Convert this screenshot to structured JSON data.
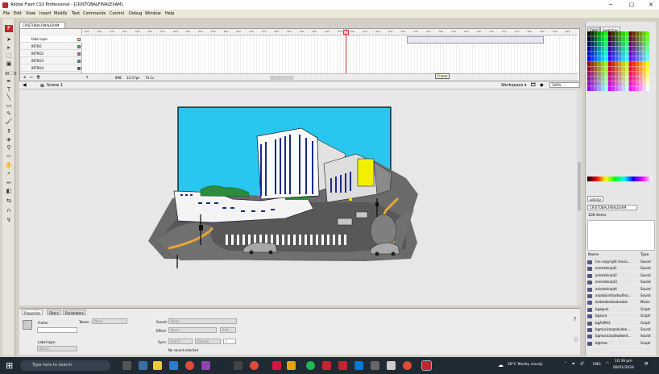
{
  "window": {
    "title": "Adobe Flash CS3 Professional - [CRISTOBALFINALEXAM]",
    "minimize": "─",
    "maximize": "▢",
    "close": "✕"
  },
  "menu": [
    "File",
    "Edit",
    "View",
    "Insert",
    "Modify",
    "Text",
    "Commands",
    "Control",
    "Debug",
    "Window",
    "Help"
  ],
  "document": {
    "tab": "CRISTOBALFINALEXAM",
    "scene": "Scene 1",
    "workspace": "Workspace ▾",
    "zoom": "100%"
  },
  "timeline": {
    "layers": [
      {
        "name": "fade layer",
        "color": "#ffee33"
      },
      {
        "name": "INTRO",
        "color": "#33cc66"
      },
      {
        "name": "INTRO2",
        "color": "#cc44cc"
      },
      {
        "name": "INTRO3",
        "color": "#33aa88"
      },
      {
        "name": "INTRO4",
        "color": "#555555"
      }
    ],
    "ruler": [
      "805",
      "810",
      "815",
      "820",
      "825",
      "830",
      "835",
      "840",
      "845",
      "850",
      "855",
      "860",
      "865",
      "870",
      "875",
      "880",
      "885",
      "890",
      "895",
      "900",
      "905",
      "910",
      "915",
      "920",
      "925",
      "930",
      "935",
      "940",
      "945",
      "950",
      "955",
      "960",
      "965",
      "970",
      "975",
      "980",
      "985",
      "990",
      "995"
    ],
    "frame": "898",
    "fps": "12.0 fps",
    "time": "74.1s",
    "tooltip": "Frame"
  },
  "properties": {
    "tabs": [
      "Properties",
      "Filters",
      "Parameters"
    ],
    "type": "Frame",
    "tween_label": "Tween:",
    "tween": "None",
    "sound_label": "Sound:",
    "sound": "None",
    "effect_label": "Effect:",
    "effect": "None",
    "edit": "Edit...",
    "sync_label": "Sync:",
    "sync": "Event",
    "repeat": "Repeat",
    "repeat_count": "1",
    "frame_label_title": "Label type:",
    "label_type": "Name",
    "no_sound": "No sound selected"
  },
  "panels": {
    "color_tab": "Color",
    "swatches_tab": "Swatches",
    "library_tab": "Library",
    "library_doc": "CRISTOBALFINALEXAM",
    "library_count": "106 items",
    "col_name": "Name",
    "col_type": "Type",
    "items": [
      {
        "name": "[no copyright music...",
        "type": "Sound"
      },
      {
        "name": "animationpt1",
        "type": "Sound"
      },
      {
        "name": "animationpt2",
        "type": "Sound"
      },
      {
        "name": "animationpt3",
        "type": "Sound"
      },
      {
        "name": "animationpt4",
        "type": "Sound"
      },
      {
        "name": "anjdaiijiinfoadoufina...",
        "type": "Sound"
      },
      {
        "name": "asdasdasdasdasdas",
        "type": "Movie"
      },
      {
        "name": "bgagum",
        "type": "Graph"
      },
      {
        "name": "bgaura",
        "type": "Graph"
      },
      {
        "name": "bgAURA2",
        "type": "Graph"
      },
      {
        "name": "bgmusicaaaahuebe...",
        "type": "Sound"
      },
      {
        "name": "bgmusicasjdiwdwed...",
        "type": "Sound"
      },
      {
        "name": "bgtrees",
        "type": "Graph"
      }
    ]
  },
  "taskbar": {
    "search": "Type here to search",
    "weather": "28°C  Mostly cloudy",
    "lang": "ENG",
    "time": "10:39 pm",
    "date": "08/01/2024"
  }
}
